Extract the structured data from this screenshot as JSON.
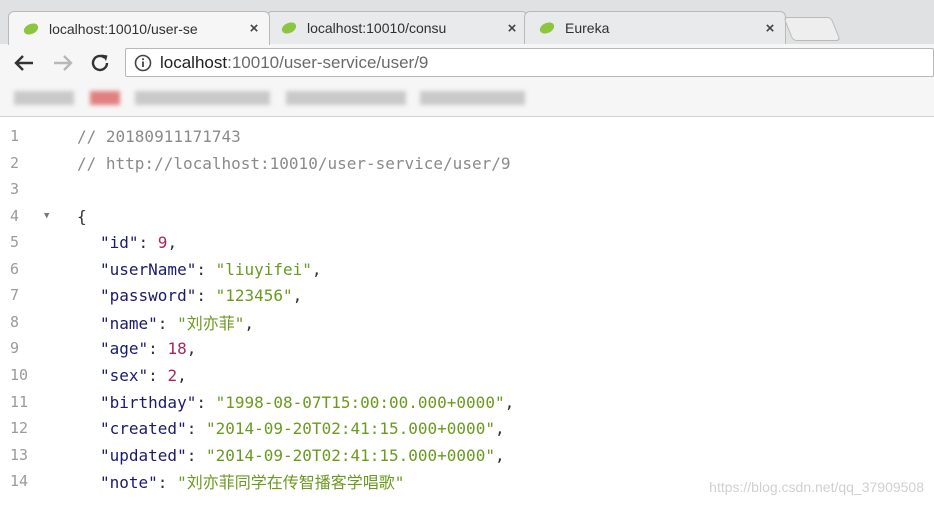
{
  "tabs": [
    {
      "title": "localhost:10010/user-se",
      "close": "×",
      "active": true
    },
    {
      "title": "localhost:10010/consu",
      "close": "×",
      "active": false
    },
    {
      "title": "Eureka",
      "close": "×",
      "active": false
    }
  ],
  "icons": {
    "tab_favicon": "spring-leaf-icon",
    "back": "back-arrow-icon",
    "forward": "forward-arrow-icon",
    "reload": "reload-icon",
    "site_info": "info-icon"
  },
  "address": {
    "host": "localhost",
    "rest": ":10010/user-service/user/9"
  },
  "code_lines": [
    {
      "n": "1",
      "fold": "",
      "text": "// 20180911171743",
      "type": "comment"
    },
    {
      "n": "2",
      "fold": "",
      "text": "// http://localhost:10010/user-service/user/9",
      "type": "comment"
    },
    {
      "n": "3",
      "fold": "",
      "text": "",
      "type": "blank"
    },
    {
      "n": "4",
      "fold": "▼",
      "text": "{",
      "type": "punc"
    },
    {
      "n": "5",
      "fold": "",
      "key": "\"id\"",
      "value": "9",
      "vtype": "num",
      "comma": ","
    },
    {
      "n": "6",
      "fold": "",
      "key": "\"userName\"",
      "value": "\"liuyifei\"",
      "vtype": "str",
      "comma": ","
    },
    {
      "n": "7",
      "fold": "",
      "key": "\"password\"",
      "value": "\"123456\"",
      "vtype": "str",
      "comma": ","
    },
    {
      "n": "8",
      "fold": "",
      "key": "\"name\"",
      "value": "\"刘亦菲\"",
      "vtype": "str",
      "comma": ","
    },
    {
      "n": "9",
      "fold": "",
      "key": "\"age\"",
      "value": "18",
      "vtype": "num",
      "comma": ","
    },
    {
      "n": "10",
      "fold": "",
      "key": "\"sex\"",
      "value": "2",
      "vtype": "num",
      "comma": ","
    },
    {
      "n": "11",
      "fold": "",
      "key": "\"birthday\"",
      "value": "\"1998-08-07T15:00:00.000+0000\"",
      "vtype": "str",
      "comma": ","
    },
    {
      "n": "12",
      "fold": "",
      "key": "\"created\"",
      "value": "\"2014-09-20T02:41:15.000+0000\"",
      "vtype": "str",
      "comma": ","
    },
    {
      "n": "13",
      "fold": "",
      "key": "\"updated\"",
      "value": "\"2014-09-20T02:41:15.000+0000\"",
      "vtype": "str",
      "comma": ","
    },
    {
      "n": "14",
      "fold": "",
      "key": "\"note\"",
      "value": "\"刘亦菲同学在传智播客学唱歌\"",
      "vtype": "str",
      "comma": ""
    }
  ],
  "watermark": "https://blog.csdn.net/qq_37909508"
}
